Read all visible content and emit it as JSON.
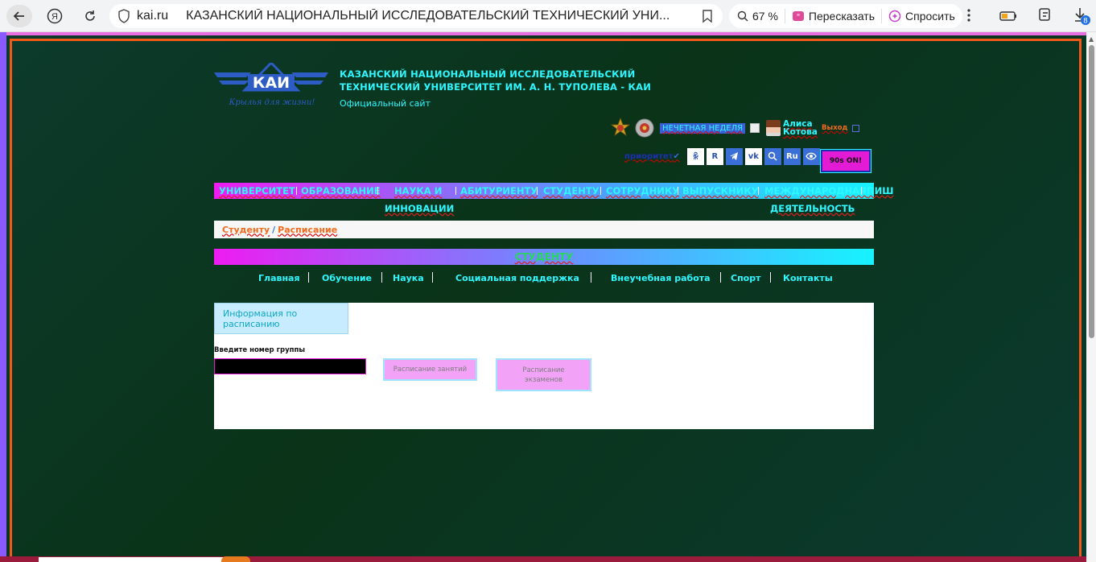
{
  "browser": {
    "domain": "kai.ru",
    "page_title": "КАЗАНСКИЙ НАЦИОНАЛЬНЫЙ ИССЛЕДОВАТЕЛЬСКИЙ ТЕХНИЧЕСКИЙ УНИ...",
    "zoom": "67 %",
    "retell_label": "Пересказать",
    "ask_label": "Спросить",
    "downloads_badge": "8"
  },
  "header": {
    "title_line1": "КАЗАНСКИЙ НАЦИОНАЛЬНЫЙ ИССЛЕДОВАТЕЛЬСКИЙ",
    "title_line2": "ТЕХНИЧЕСКИЙ УНИВЕРСИТЕТ ИМ. А. Н. ТУПОЛЕВА - КАИ",
    "subtitle": "Официальный сайт",
    "logo_text": "КАИ",
    "logo_slogan": "Крылья для жизни!",
    "week": "НЕЧЕТНАЯ НЕДЕЛЯ",
    "user_first": "Алиса",
    "user_last": "Котова",
    "logout": "Выход",
    "priority": "приоритет",
    "lang": "Ru",
    "mode_button": "90s ON!"
  },
  "mainnav": [
    {
      "line1": "УНИВЕРСИТЕТ",
      "line2": ""
    },
    {
      "line1": "ОБРАЗОВАНИЕ",
      "line2": ""
    },
    {
      "line1": "НАУКА И",
      "line2": "ИННОВАЦИИ"
    },
    {
      "line1": "АБИТУРИЕНТУ",
      "line2": ""
    },
    {
      "line1": "СТУДЕНТУ",
      "line2": ""
    },
    {
      "line1": "СОТРУДНИКУ",
      "line2": ""
    },
    {
      "line1": "ВЫПУСКНИКУ",
      "line2": ""
    },
    {
      "line1": "МЕЖДУНАРОДНАЯ",
      "line2": "ДЕЯТЕЛЬНОСТЬ"
    },
    {
      "line1": "ПИШ",
      "line2": ""
    }
  ],
  "breadcrumb": {
    "parent": "Студенту",
    "current": "Расписание"
  },
  "section": {
    "banner": "СТУДЕНТУ",
    "subnav": [
      "Главная",
      "Обучение",
      "Наука",
      "Социальная поддержка",
      "Внеучебная работа",
      "Спорт",
      "Контакты"
    ]
  },
  "schedule": {
    "info_tab": "Информация по расписанию",
    "group_label": "Введите номер группы",
    "group_value": "",
    "classes_button": "Расписание занятий",
    "exams_button": "Расписание экзаменов"
  }
}
